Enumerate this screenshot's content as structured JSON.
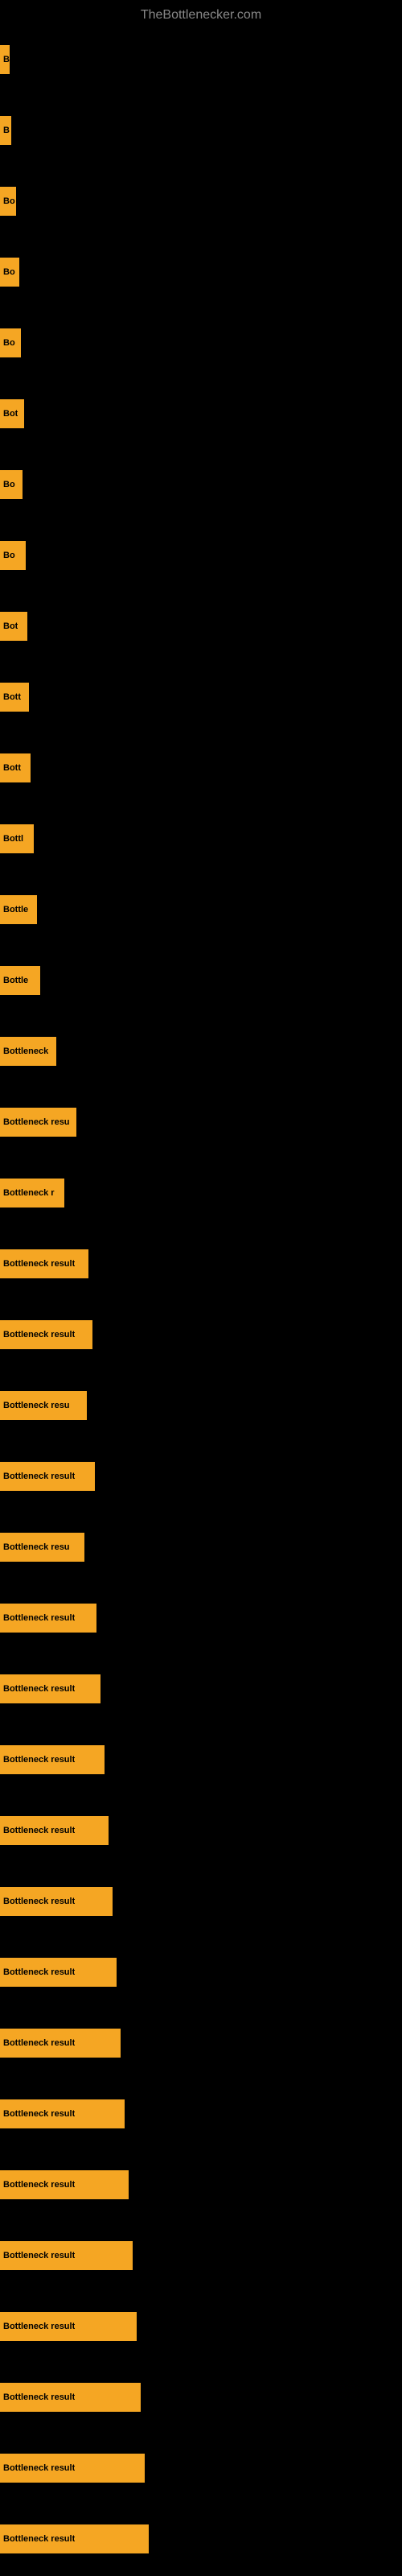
{
  "site": {
    "title": "TheBottlenecker.com"
  },
  "bars": [
    {
      "label": "B",
      "width": 12
    },
    {
      "label": "B",
      "width": 14
    },
    {
      "label": "Bo",
      "width": 20
    },
    {
      "label": "Bo",
      "width": 24
    },
    {
      "label": "Bo",
      "width": 26
    },
    {
      "label": "Bot",
      "width": 30
    },
    {
      "label": "Bo",
      "width": 28
    },
    {
      "label": "Bo",
      "width": 32
    },
    {
      "label": "Bot",
      "width": 34
    },
    {
      "label": "Bott",
      "width": 36
    },
    {
      "label": "Bott",
      "width": 38
    },
    {
      "label": "Bottl",
      "width": 42
    },
    {
      "label": "Bottle",
      "width": 46
    },
    {
      "label": "Bottle",
      "width": 50
    },
    {
      "label": "Bottleneck",
      "width": 70
    },
    {
      "label": "Bottleneck resu",
      "width": 95
    },
    {
      "label": "Bottleneck r",
      "width": 80
    },
    {
      "label": "Bottleneck result",
      "width": 110
    },
    {
      "label": "Bottleneck result",
      "width": 115
    },
    {
      "label": "Bottleneck resu",
      "width": 108
    },
    {
      "label": "Bottleneck result",
      "width": 118
    },
    {
      "label": "Bottleneck resu",
      "width": 105
    },
    {
      "label": "Bottleneck result",
      "width": 120
    },
    {
      "label": "Bottleneck result",
      "width": 125
    },
    {
      "label": "Bottleneck result",
      "width": 130
    },
    {
      "label": "Bottleneck result",
      "width": 135
    },
    {
      "label": "Bottleneck result",
      "width": 140
    },
    {
      "label": "Bottleneck result",
      "width": 145
    },
    {
      "label": "Bottleneck result",
      "width": 150
    },
    {
      "label": "Bottleneck result",
      "width": 155
    },
    {
      "label": "Bottleneck result",
      "width": 160
    },
    {
      "label": "Bottleneck result",
      "width": 165
    },
    {
      "label": "Bottleneck result",
      "width": 170
    },
    {
      "label": "Bottleneck result",
      "width": 175
    },
    {
      "label": "Bottleneck result",
      "width": 180
    },
    {
      "label": "Bottleneck result",
      "width": 185
    }
  ]
}
